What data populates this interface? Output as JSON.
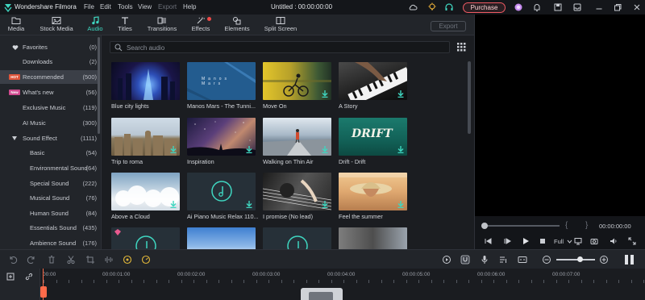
{
  "app": {
    "name": "Wondershare Filmora",
    "menus": [
      "File",
      "Edit",
      "Tools",
      "View",
      "Export",
      "Help"
    ],
    "disabled_menus": [
      "Export"
    ],
    "document_title": "Untitled : 00:00:00:00",
    "purchase_label": "Purchase"
  },
  "tabs": [
    {
      "label": "Media",
      "icon": "folder-icon"
    },
    {
      "label": "Stock Media",
      "icon": "stock-media-icon"
    },
    {
      "label": "Audio",
      "icon": "music-note-icon",
      "active": true
    },
    {
      "label": "Titles",
      "icon": "titles-icon"
    },
    {
      "label": "Transitions",
      "icon": "transitions-icon"
    },
    {
      "label": "Effects",
      "icon": "effects-icon",
      "badge": true
    },
    {
      "label": "Elements",
      "icon": "elements-icon"
    },
    {
      "label": "Split Screen",
      "icon": "split-screen-icon"
    }
  ],
  "export_label": "Export",
  "sidebar": {
    "items": [
      {
        "label": "Favorites",
        "count": "(0)",
        "icon": "heart-icon"
      },
      {
        "label": "Downloads",
        "count": "(2)"
      },
      {
        "label": "Recommended",
        "count": "(500)",
        "badge": "HOT",
        "active": true
      },
      {
        "label": "What's new",
        "count": "(56)",
        "badge": "New"
      },
      {
        "label": "Exclusive Music",
        "count": "(119)"
      },
      {
        "label": "AI Music",
        "count": "(300)"
      },
      {
        "label": "Sound Effect",
        "count": "(1111)",
        "expanded": true
      },
      {
        "label": "Basic",
        "count": "(54)"
      },
      {
        "label": "Environmental Sound",
        "count": "(64)"
      },
      {
        "label": "Special Sound",
        "count": "(222)"
      },
      {
        "label": "Musical Sound",
        "count": "(76)"
      },
      {
        "label": "Human Sound",
        "count": "(84)"
      },
      {
        "label": "Essentials Sound",
        "count": "(435)"
      },
      {
        "label": "Ambience Sound",
        "count": "(176)"
      }
    ]
  },
  "search": {
    "placeholder": "Search audio"
  },
  "cards": [
    {
      "title": "Blue city lights"
    },
    {
      "title": "Manos Mars - The Tunni..."
    },
    {
      "title": "Move On"
    },
    {
      "title": "A Story"
    },
    {
      "title": "Trip to roma"
    },
    {
      "title": "Inspiration"
    },
    {
      "title": "Walking on Thin Air"
    },
    {
      "title": "Drift - Drift"
    },
    {
      "title": "Above a Cloud"
    },
    {
      "title": "Ai Piano Music Relax 110..."
    },
    {
      "title": "I promise (No lead)"
    },
    {
      "title": "Feel the summer"
    }
  ],
  "thumb_text": {
    "manos": "Manos Mars",
    "drift": "DRIFT"
  },
  "preview": {
    "timecode": "00:00:00:00",
    "zoom_label": "Full",
    "brackets": [
      "{",
      "}"
    ]
  },
  "timeline": {
    "ticks": [
      "00:00",
      "00:00:01:00",
      "00:00:02:00",
      "00:00:03:00",
      "00:00:04:00",
      "00:00:05:00",
      "00:00:06:00",
      "00:00:07:00"
    ]
  },
  "colors": {
    "accent": "#3fd6c0",
    "purchase": "#ef5a63",
    "playhead": "#ff6b4a"
  }
}
